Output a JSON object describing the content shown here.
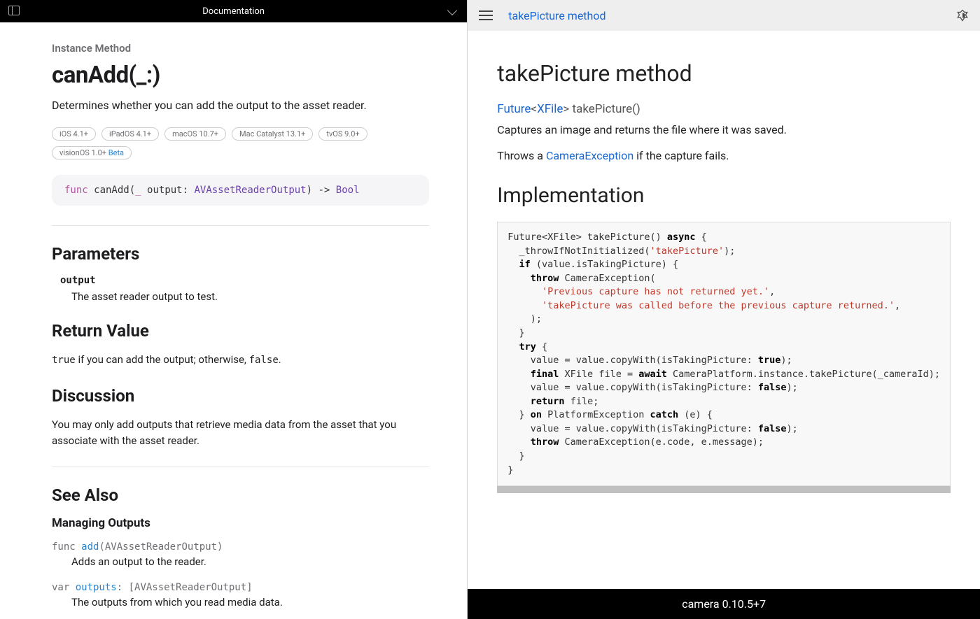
{
  "left": {
    "header_title": "Documentation",
    "eyebrow": "Instance Method",
    "title": "canAdd(_:)",
    "summary": "Determines whether you can add the output to the asset reader.",
    "platforms": [
      {
        "label": "iOS 4.1+",
        "beta": ""
      },
      {
        "label": "iPadOS 4.1+",
        "beta": ""
      },
      {
        "label": "macOS 10.7+",
        "beta": ""
      },
      {
        "label": "Mac Catalyst 13.1+",
        "beta": ""
      },
      {
        "label": "tvOS 9.0+",
        "beta": ""
      },
      {
        "label": "visionOS 1.0+",
        "beta": "Beta"
      }
    ],
    "declaration": {
      "kw_func": "func",
      "name": " canAdd",
      "paren_open": "(",
      "underscore": "_",
      "param": " output: ",
      "type": "AVAssetReaderOutput",
      "paren_close": ")",
      "arrow": " -> ",
      "ret": "Bool"
    },
    "parameters_heading": "Parameters",
    "param_name": "output",
    "param_desc": "The asset reader output to test.",
    "return_heading": "Return Value",
    "return_pre": "",
    "return_code_true": "true",
    "return_mid": " if you can add the output; otherwise, ",
    "return_code_false": "false",
    "return_post": ".",
    "discussion_heading": "Discussion",
    "discussion_body": "You may only add outputs that retrieve media data from the asset that you associate with the asset reader.",
    "seealso_heading": "See Also",
    "seealso_sub": "Managing Outputs",
    "seealso_items": [
      {
        "prefix": "func ",
        "link": "add",
        "suffix": "(AVAssetReaderOutput)",
        "desc": "Adds an output to the reader."
      },
      {
        "prefix": "var ",
        "link": "outputs",
        "suffix": ": [AVAssetReaderOutput]",
        "desc": "The outputs from which you read media data."
      }
    ]
  },
  "right": {
    "breadcrumb": "takePicture method",
    "title": "takePicture method",
    "sig_future": "Future",
    "sig_lt": "<",
    "sig_xfile": "XFile",
    "sig_gt": ">",
    "sig_rest": " takePicture()",
    "desc": "Captures an image and returns the file where it was saved.",
    "throws_pre": "Throws a ",
    "throws_link": "CameraException",
    "throws_post": " if the capture fails.",
    "impl_heading": "Implementation",
    "code": {
      "l1a": "Future<XFile> takePicture() ",
      "l1b": "async",
      "l1c": " {",
      "l2": "  _throwIfNotInitialized(",
      "l2s": "'takePicture'",
      "l2e": ");",
      "l3a": "  ",
      "l3b": "if",
      "l3c": " (value.isTakingPicture) {",
      "l4a": "    ",
      "l4b": "throw",
      "l4c": " CameraException(",
      "l5": "      ",
      "l5s": "'Previous capture has not returned yet.'",
      "l5e": ",",
      "l6": "      ",
      "l6s": "'takePicture was called before the previous capture returned.'",
      "l6e": ",",
      "l7": "    );",
      "l8": "  }",
      "l9a": "  ",
      "l9b": "try",
      "l9c": " {",
      "l10a": "    value = value.copyWith(isTakingPicture: ",
      "l10b": "true",
      "l10c": ");",
      "l11a": "    ",
      "l11b": "final",
      "l11c": " XFile file = ",
      "l11d": "await",
      "l11e": " CameraPlatform.instance.takePicture(_cameraId);",
      "l12a": "    value = value.copyWith(isTakingPicture: ",
      "l12b": "false",
      "l12c": ");",
      "l13a": "    ",
      "l13b": "return",
      "l13c": " file;",
      "l14a": "  } ",
      "l14b": "on",
      "l14c": " PlatformException ",
      "l14d": "catch",
      "l14e": " (e) {",
      "l15a": "    value = value.copyWith(isTakingPicture: ",
      "l15b": "false",
      "l15c": ");",
      "l16a": "    ",
      "l16b": "throw",
      "l16c": " CameraException(e.code, e.message);",
      "l17": "  }",
      "l18": "}"
    },
    "footer": "camera 0.10.5+7"
  }
}
